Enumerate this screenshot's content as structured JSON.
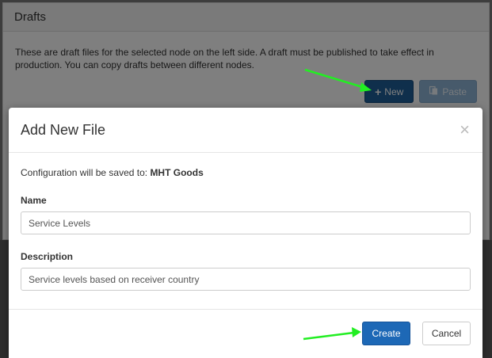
{
  "background": {
    "panel_title": "Drafts",
    "description": "These are draft files for the selected node on the left side. A draft must be published to take effect in production. You can copy drafts between different nodes.",
    "new_button": "New",
    "paste_button": "Paste"
  },
  "modal": {
    "title": "Add New File",
    "close_glyph": "×",
    "saved_prefix": "Configuration will be saved to:",
    "saved_target": "MHT Goods",
    "name_label": "Name",
    "name_value": "Service Levels",
    "description_label": "Description",
    "description_value": "Service levels based on receiver country",
    "create_button": "Create",
    "cancel_button": "Cancel"
  },
  "annotation_color": "#22ee22",
  "icons": {
    "new": "plus-icon",
    "paste": "paste-icon",
    "close": "close-icon"
  }
}
